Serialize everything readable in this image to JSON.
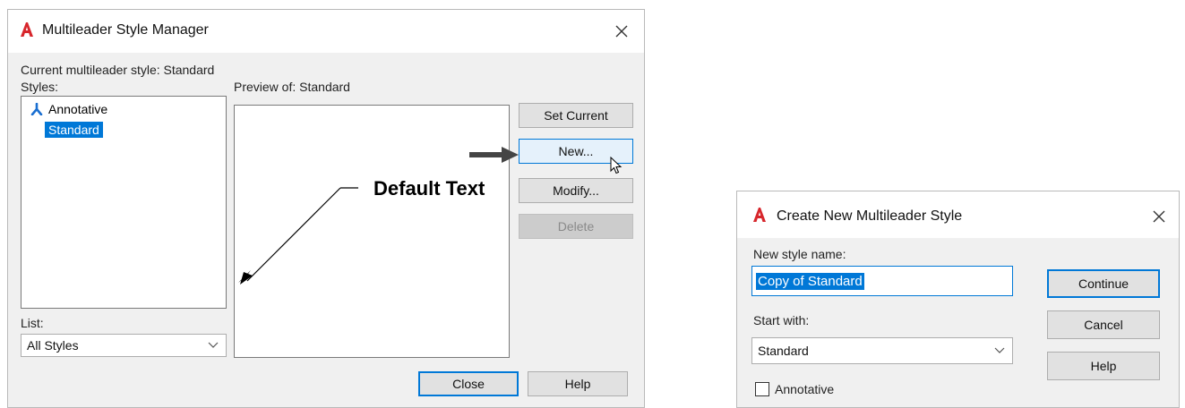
{
  "manager": {
    "title": "Multileader Style Manager",
    "current_style_label": "Current multileader style: Standard",
    "styles_label": "Styles:",
    "styles": [
      {
        "label": "Annotative",
        "annotative": true
      },
      {
        "label": "Standard",
        "selected": true
      }
    ],
    "preview_label": "Preview of: Standard",
    "preview_text": "Default Text",
    "list_label": "List:",
    "list_value": "All Styles",
    "buttons": {
      "set_current": "Set Current",
      "new": "New...",
      "modify": "Modify...",
      "delete": "Delete",
      "close": "Close",
      "help": "Help"
    }
  },
  "create": {
    "title": "Create New Multileader Style",
    "new_name_label": "New style name:",
    "new_name_value": "Copy of Standard",
    "start_with_label": "Start with:",
    "start_with_value": "Standard",
    "annotative_label": "Annotative",
    "annotative_checked": false,
    "buttons": {
      "continue": "Continue",
      "cancel": "Cancel",
      "help": "Help"
    }
  },
  "colors": {
    "accent": "#0078d7",
    "autocad_red": "#d7262c",
    "dialog_bg": "#f0f0f0"
  },
  "icons": [
    "autocad-logo-icon",
    "close-icon",
    "annotative-icon",
    "chevron-down-icon",
    "arrow-right-icon",
    "mouse-cursor-icon"
  ]
}
